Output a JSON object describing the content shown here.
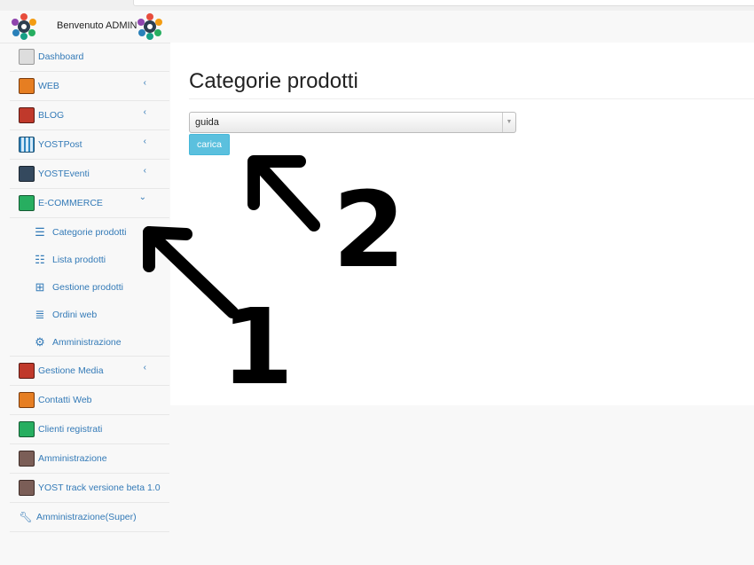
{
  "header": {
    "welcome": "Benvenuto ADMIN"
  },
  "sidebar": {
    "items": [
      {
        "label": "Dashboard",
        "icon": "dashboard-icon",
        "chevron": ""
      },
      {
        "label": "WEB",
        "icon": "web-icon",
        "chevron": "‹"
      },
      {
        "label": "BLOG",
        "icon": "blog-icon",
        "chevron": "‹"
      },
      {
        "label": "YOSTPost",
        "icon": "grid-icon",
        "chevron": "‹"
      },
      {
        "label": "YOSTEventi",
        "icon": "calendar-icon",
        "chevron": "‹"
      },
      {
        "label": "E-COMMERCE",
        "icon": "shopping-bag-icon",
        "chevron": "⌄"
      }
    ],
    "submenu": [
      {
        "label": "Categorie prodotti",
        "icon": "list-alt-icon"
      },
      {
        "label": "Lista prodotti",
        "icon": "list-icon"
      },
      {
        "label": "Gestione prodotti",
        "icon": "plus-square-icon"
      },
      {
        "label": "Ordini web",
        "icon": "tasks-icon"
      },
      {
        "label": "Amministrazione",
        "icon": "cogs-icon"
      }
    ],
    "items_after": [
      {
        "label": "Gestione Media",
        "icon": "media-icon",
        "chevron": "‹"
      },
      {
        "label": "Contatti Web",
        "icon": "mail-icon",
        "chevron": ""
      },
      {
        "label": "Clienti registrati",
        "icon": "id-card-icon",
        "chevron": ""
      },
      {
        "label": "Amministrazione",
        "icon": "admin-gear-icon",
        "chevron": ""
      },
      {
        "label": "YOST track versione beta 1.0",
        "icon": "track-gear-icon",
        "chevron": ""
      },
      {
        "label": "Amministrazione(Super)",
        "icon": "wrench-icon",
        "chevron": ""
      }
    ]
  },
  "main": {
    "title": "Categorie prodotti",
    "select_value": "guida",
    "load_button": "carica"
  },
  "annotations": {
    "arrow1_number": "1",
    "arrow2_number": "2"
  },
  "colors": {
    "link": "#337ab7",
    "button": "#5bc0de"
  }
}
